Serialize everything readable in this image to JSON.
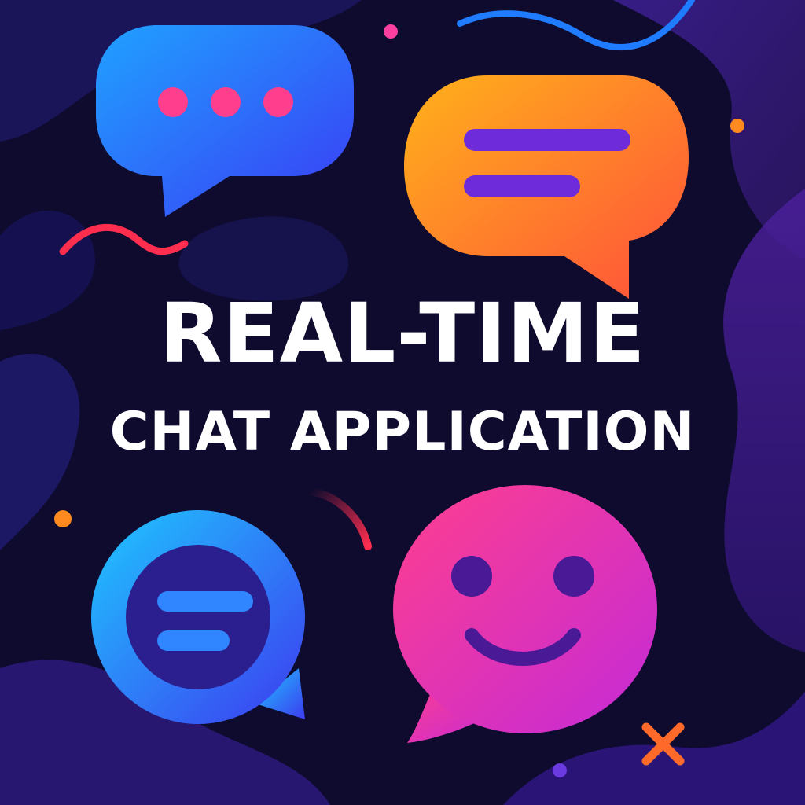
{
  "headline": {
    "main": "REAL-TIME",
    "sub": "CHAT APPLICATION"
  },
  "icons": [
    {
      "name": "typing-bubble-icon",
      "gradient": [
        "#1fa2ff",
        "#3b3bf5"
      ],
      "dots_color": "#ff3f8e"
    },
    {
      "name": "message-bubble-icon",
      "gradient": [
        "#ffb21a",
        "#ff4f3b"
      ],
      "lines_color": "#6d2bd9"
    },
    {
      "name": "round-chat-icon",
      "gradient": [
        "#1ec8ff",
        "#3d3af0"
      ],
      "inner_color": "#2b1f8f",
      "lines_color": "#2f86ff"
    },
    {
      "name": "smiley-bubble-icon",
      "gradient": [
        "#ff3f8e",
        "#c42ad8"
      ],
      "face_color": "#4a1996"
    }
  ],
  "colors": {
    "background": "#0e0b2e",
    "blob": "#2a1a78",
    "accent_red": "#ff2e4f",
    "accent_orange": "#ff8a1f",
    "accent_blue": "#1f7bff",
    "accent_magenta": "#ff3fa0",
    "accent_purple": "#6b3ae0",
    "text": "#ffffff"
  }
}
